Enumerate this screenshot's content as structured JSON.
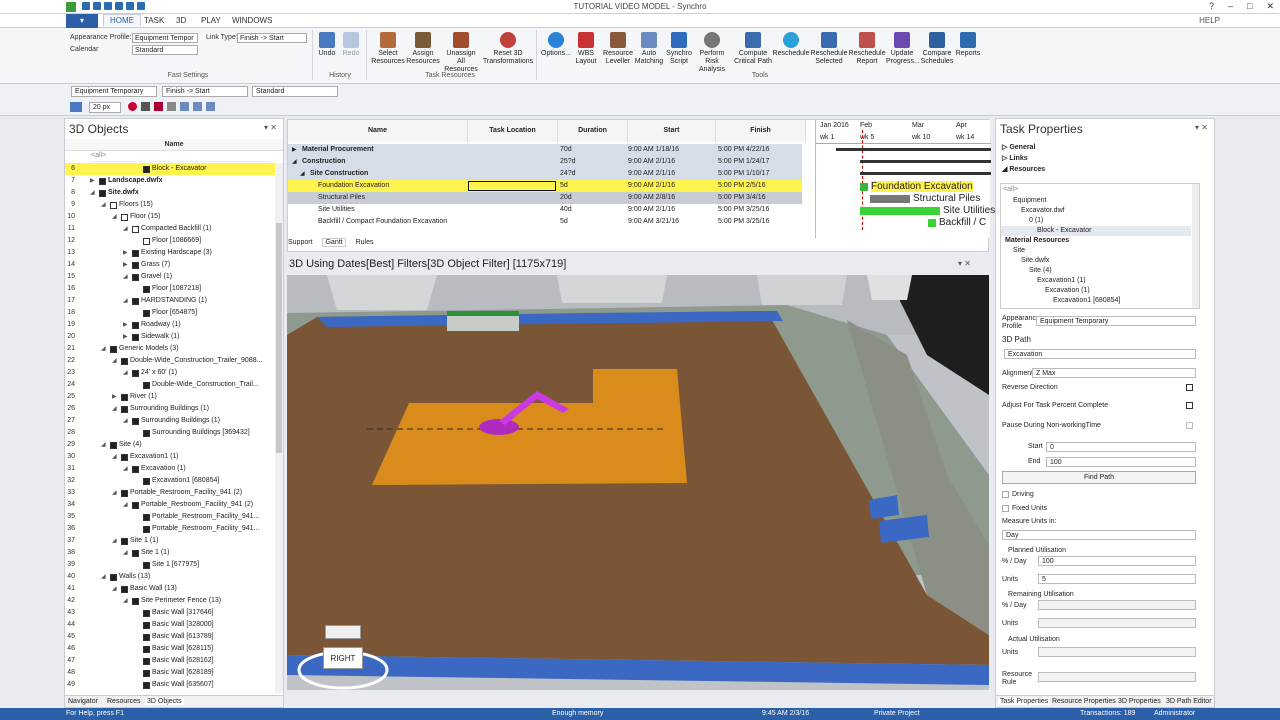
{
  "window": {
    "title": "TUTORIAL VIDEO MODEL - Synchro",
    "controls": [
      "?",
      "–",
      "□",
      "✕"
    ]
  },
  "ribbon_tabs": {
    "file": "",
    "home": "HOME",
    "task": "TASK",
    "d3": "3D",
    "play": "PLAY",
    "windows": "WINDOWS",
    "help": "HELP"
  },
  "fast_settings": {
    "appearance_label": "Appearance Profile:",
    "appearance_value": "Equipment Tempor",
    "link_label": "Link Type:",
    "link_value": "Finish -> Start",
    "calendar_label": "Calendar",
    "calendar_value": "Standard",
    "group": "Fast Settings"
  },
  "history": {
    "undo": "Undo",
    "redo": "Redo",
    "group": "History"
  },
  "task_resources": {
    "select": "Select Resources",
    "assign": "Assign Resources",
    "unassign": "Unassign All Resources",
    "reset": "Reset 3D Transformations",
    "group": "Task Resources"
  },
  "tools": {
    "options": "Options...",
    "wbs": "WBS Layout",
    "leveller": "Resource Leveller",
    "auto": "Auto Matching",
    "script": "Synchro Script",
    "risk": "Perform Risk Analysis",
    "critical": "Compute Critical Path",
    "reschedule": "Reschedule",
    "resched_sel": "Reschedule Selected",
    "resched_rep": "Reschedule Report",
    "update": "Update Progress...",
    "compare": "Compare Schedules",
    "reports": "Reports",
    "group": "Tools"
  },
  "toolbar": {
    "profile": "Equipment Temporary",
    "link": "Finish -> Start",
    "calendar": "Standard",
    "px": "20 px"
  },
  "objects_panel": {
    "title": "3D Objects",
    "col_name": "Name",
    "filter": "<all>",
    "rows": [
      {
        "n": "6",
        "label": "Block - Excavator",
        "indent": 5,
        "cb": "on",
        "exp": "",
        "hl": true
      },
      {
        "n": "7",
        "label": "Landscape.dwfx",
        "indent": 1,
        "cb": "on",
        "exp": "▶",
        "bold": true
      },
      {
        "n": "8",
        "label": "Site.dwfx",
        "indent": 1,
        "cb": "on",
        "exp": "◢",
        "bold": true
      },
      {
        "n": "9",
        "label": "Floors (15)",
        "indent": 2,
        "cb": "off",
        "exp": "◢"
      },
      {
        "n": "10",
        "label": "Floor (15)",
        "indent": 3,
        "cb": "off",
        "exp": "◢"
      },
      {
        "n": "11",
        "label": "Compacted Backfill (1)",
        "indent": 4,
        "cb": "off",
        "exp": "◢"
      },
      {
        "n": "12",
        "label": "Floor [1086669]",
        "indent": 5,
        "cb": "off",
        "exp": ""
      },
      {
        "n": "13",
        "label": "Existing Hardscape (3)",
        "indent": 4,
        "cb": "on",
        "exp": "▶"
      },
      {
        "n": "14",
        "label": "Grass (7)",
        "indent": 4,
        "cb": "on",
        "exp": "▶"
      },
      {
        "n": "15",
        "label": "Gravel (1)",
        "indent": 4,
        "cb": "on",
        "exp": "◢"
      },
      {
        "n": "16",
        "label": "Floor [1087218]",
        "indent": 5,
        "cb": "on",
        "exp": ""
      },
      {
        "n": "17",
        "label": "HARDSTANDING (1)",
        "indent": 4,
        "cb": "on",
        "exp": "◢"
      },
      {
        "n": "18",
        "label": "Floor [654875]",
        "indent": 5,
        "cb": "on",
        "exp": ""
      },
      {
        "n": "19",
        "label": "Roadway (1)",
        "indent": 4,
        "cb": "on",
        "exp": "▶"
      },
      {
        "n": "20",
        "label": "Sidewalk (1)",
        "indent": 4,
        "cb": "on",
        "exp": "▶"
      },
      {
        "n": "21",
        "label": "Generic Models (3)",
        "indent": 2,
        "cb": "on",
        "exp": "◢"
      },
      {
        "n": "22",
        "label": "Double-Wide_Construction_Trailer_9088...",
        "indent": 3,
        "cb": "on",
        "exp": "◢"
      },
      {
        "n": "23",
        "label": "24' x 60' (1)",
        "indent": 4,
        "cb": "on",
        "exp": "◢"
      },
      {
        "n": "24",
        "label": "Double-Wide_Construction_Trail...",
        "indent": 5,
        "cb": "on",
        "exp": ""
      },
      {
        "n": "25",
        "label": "River (1)",
        "indent": 3,
        "cb": "on",
        "exp": "▶"
      },
      {
        "n": "26",
        "label": "Surrounding Buildings (1)",
        "indent": 3,
        "cb": "on",
        "exp": "◢"
      },
      {
        "n": "27",
        "label": "Surrounding Buildings (1)",
        "indent": 4,
        "cb": "on",
        "exp": "◢"
      },
      {
        "n": "28",
        "label": "Surrounding Buildings [369432]",
        "indent": 5,
        "cb": "on",
        "exp": ""
      },
      {
        "n": "29",
        "label": "Site (4)",
        "indent": 2,
        "cb": "on",
        "exp": "◢"
      },
      {
        "n": "30",
        "label": "Excavation1 (1)",
        "indent": 3,
        "cb": "on",
        "exp": "◢"
      },
      {
        "n": "31",
        "label": "Excavation (1)",
        "indent": 4,
        "cb": "on",
        "exp": "◢"
      },
      {
        "n": "32",
        "label": "Excavation1 [680854]",
        "indent": 5,
        "cb": "on",
        "exp": ""
      },
      {
        "n": "33",
        "label": "Portable_Restroom_Facility_941 (2)",
        "indent": 3,
        "cb": "on",
        "exp": "◢"
      },
      {
        "n": "34",
        "label": "Portable_Restroom_Facility_941 (2)",
        "indent": 4,
        "cb": "on",
        "exp": "◢"
      },
      {
        "n": "35",
        "label": "Portable_Restroom_Facility_941...",
        "indent": 5,
        "cb": "on",
        "exp": ""
      },
      {
        "n": "36",
        "label": "Portable_Restroom_Facility_941...",
        "indent": 5,
        "cb": "on",
        "exp": ""
      },
      {
        "n": "37",
        "label": "Site 1 (1)",
        "indent": 3,
        "cb": "on",
        "exp": "◢"
      },
      {
        "n": "38",
        "label": "Site 1 (1)",
        "indent": 4,
        "cb": "on",
        "exp": "◢"
      },
      {
        "n": "39",
        "label": "Site 1 [677975]",
        "indent": 5,
        "cb": "on",
        "exp": ""
      },
      {
        "n": "40",
        "label": "Walls (13)",
        "indent": 2,
        "cb": "on",
        "exp": "◢"
      },
      {
        "n": "41",
        "label": "Basic Wall (13)",
        "indent": 3,
        "cb": "on",
        "exp": "◢"
      },
      {
        "n": "42",
        "label": "Site Perimeter Fence (13)",
        "indent": 4,
        "cb": "on",
        "exp": "◢"
      },
      {
        "n": "43",
        "label": "Basic Wall [317646]",
        "indent": 5,
        "cb": "on",
        "exp": ""
      },
      {
        "n": "44",
        "label": "Basic Wall [328000]",
        "indent": 5,
        "cb": "on",
        "exp": ""
      },
      {
        "n": "45",
        "label": "Basic Wall [613789]",
        "indent": 5,
        "cb": "on",
        "exp": ""
      },
      {
        "n": "46",
        "label": "Basic Wall [628115]",
        "indent": 5,
        "cb": "on",
        "exp": ""
      },
      {
        "n": "47",
        "label": "Basic Wall [628162]",
        "indent": 5,
        "cb": "on",
        "exp": ""
      },
      {
        "n": "48",
        "label": "Basic Wall [628189]",
        "indent": 5,
        "cb": "on",
        "exp": ""
      },
      {
        "n": "49",
        "label": "Basic Wall [635607]",
        "indent": 5,
        "cb": "on",
        "exp": ""
      }
    ],
    "tabs": {
      "navigator": "Navigator",
      "resources": "Resources",
      "objects": "3D Objects"
    }
  },
  "gantt": {
    "cols": {
      "name": "Name",
      "location": "Task Location",
      "duration": "Duration",
      "start": "Start",
      "finish": "Finish"
    },
    "rows": [
      {
        "name": "Material Procurement",
        "dur": "70d",
        "start": "9:00 AM 1/18/16",
        "finish": "5:00 PM 4/22/16",
        "style": "gsum",
        "indent": 1,
        "exp": "▶"
      },
      {
        "name": "Construction",
        "dur": "25?d",
        "start": "9:00 AM 2/1/16",
        "finish": "5:00 PM 1/24/17",
        "style": "gsum",
        "indent": 1,
        "exp": "◢"
      },
      {
        "name": "Site Construction",
        "dur": "24?d",
        "start": "9:00 AM 2/1/16",
        "finish": "5:00 PM 1/10/17",
        "style": "gsum",
        "indent": 2,
        "exp": "◢"
      },
      {
        "name": "Foundation Excavation",
        "dur": "5d",
        "start": "9:00 AM 2/1/16",
        "finish": "5:00 PM 2/5/16",
        "style": "ghl",
        "indent": 3,
        "exp": ""
      },
      {
        "name": "Structural Piles",
        "dur": "20d",
        "start": "9:00 AM 2/8/16",
        "finish": "5:00 PM 3/4/16",
        "style": "gsel",
        "indent": 3,
        "exp": ""
      },
      {
        "name": "Site Utilities",
        "dur": "40d",
        "start": "9:00 AM 2/1/16",
        "finish": "5:00 PM 3/25/16",
        "style": "",
        "indent": 3,
        "exp": ""
      },
      {
        "name": "Backfill / Compact  Foundation Excavation",
        "dur": "5d",
        "start": "9:00 AM 3/21/16",
        "finish": "5:00 PM 3/25/16",
        "style": "",
        "indent": 3,
        "exp": ""
      }
    ],
    "chart": {
      "months": [
        "Jan 2016",
        "Feb",
        "Mar",
        "Apr"
      ],
      "weeks": [
        "wk 1",
        "wk 5",
        "wk 10",
        "wk 14"
      ],
      "labels": [
        "Foundation Excavation",
        "Structural Piles",
        "Site Utilities",
        "Backfill / C"
      ]
    },
    "tabs": {
      "support": "Support",
      "gantt": "Gantt",
      "rules": "Rules"
    }
  },
  "viewport": {
    "title": "3D Using Dates[Best] Filters[3D Object Filter] [1175x719]",
    "nav_label": "RIGHT"
  },
  "task_properties": {
    "title": "Task Properties",
    "sections": [
      "General",
      "Links",
      "Resources"
    ],
    "filter": "<all>",
    "tree": [
      {
        "label": "Equipment",
        "indent": 1
      },
      {
        "label": "Excavator.dwf",
        "indent": 2
      },
      {
        "label": "0 (1)",
        "indent": 3
      },
      {
        "label": "Block - Excavator",
        "indent": 4
      },
      {
        "label": "Material Resources",
        "indent": 0,
        "bold": true
      },
      {
        "label": "Site",
        "indent": 1
      },
      {
        "label": "Site.dwfx",
        "indent": 2
      },
      {
        "label": "Site (4)",
        "indent": 3
      },
      {
        "label": "Excavation1 (1)",
        "indent": 4
      },
      {
        "label": "Excavation (1)",
        "indent": 5
      },
      {
        "label": "Excavation1 [680854]",
        "indent": 6
      }
    ],
    "appearance_label": "Appearance Profile",
    "appearance_value": "Equipment Temporary",
    "path_label": "3D Path",
    "path_value": "Excavation",
    "alignment_label": "Alignment",
    "alignment_value": "Z Max",
    "reverse": "Reverse Direction",
    "adjust": "Adjust For Task Percent Complete",
    "pause": "Pause During Non-workingTime",
    "start_label": "Start",
    "start_value": "0",
    "end_label": "End",
    "end_value": "100",
    "find_path": "Find Path",
    "driving": "Driving",
    "fixed_units": "Fixed Units",
    "measure_label": "Measure Units in:",
    "measure_value": "Day",
    "planned": "Planned Utilisation",
    "pct_day": "% / Day",
    "planned_pct": "100",
    "units": "Units",
    "planned_units": "5",
    "remaining": "Remaining Utilisation",
    "actual": "Actual Utilisation",
    "resource_rule": "Resource Rule",
    "tabs": {
      "task": "Task Properties",
      "resource": "Resource Properties",
      "props3d": "3D Properties",
      "path": "3D Path Editor"
    }
  },
  "status": {
    "help": "For Help, press F1",
    "memory": "Enough memory",
    "time": "9:45 AM 2/3/16",
    "project": "Private Project",
    "transactions": "Transactions: 189",
    "user": "Administrator"
  }
}
